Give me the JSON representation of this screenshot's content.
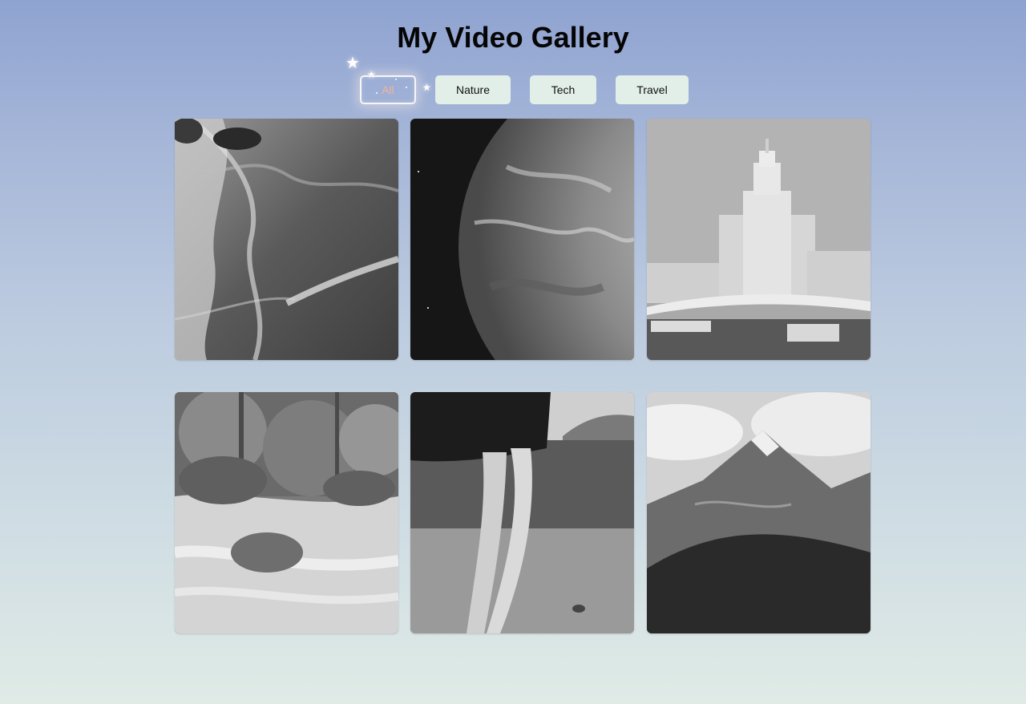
{
  "page": {
    "title": "My Video Gallery"
  },
  "filters": [
    {
      "label": "All",
      "active": true
    },
    {
      "label": "Nature",
      "active": false
    },
    {
      "label": "Tech",
      "active": false
    },
    {
      "label": "Travel",
      "active": false
    }
  ],
  "gallery": {
    "items": [
      {
        "subject": "ocean-waves"
      },
      {
        "subject": "earth-from-space"
      },
      {
        "subject": "city-building-river"
      },
      {
        "subject": "forest-stream"
      },
      {
        "subject": "person-walking-beach"
      },
      {
        "subject": "mountain-peak"
      }
    ]
  },
  "colors": {
    "background_top": "#8fa3d1",
    "background_bottom": "#e0ebe6",
    "button_bg": "#e2efe8",
    "active_text": "#f3b49a"
  }
}
